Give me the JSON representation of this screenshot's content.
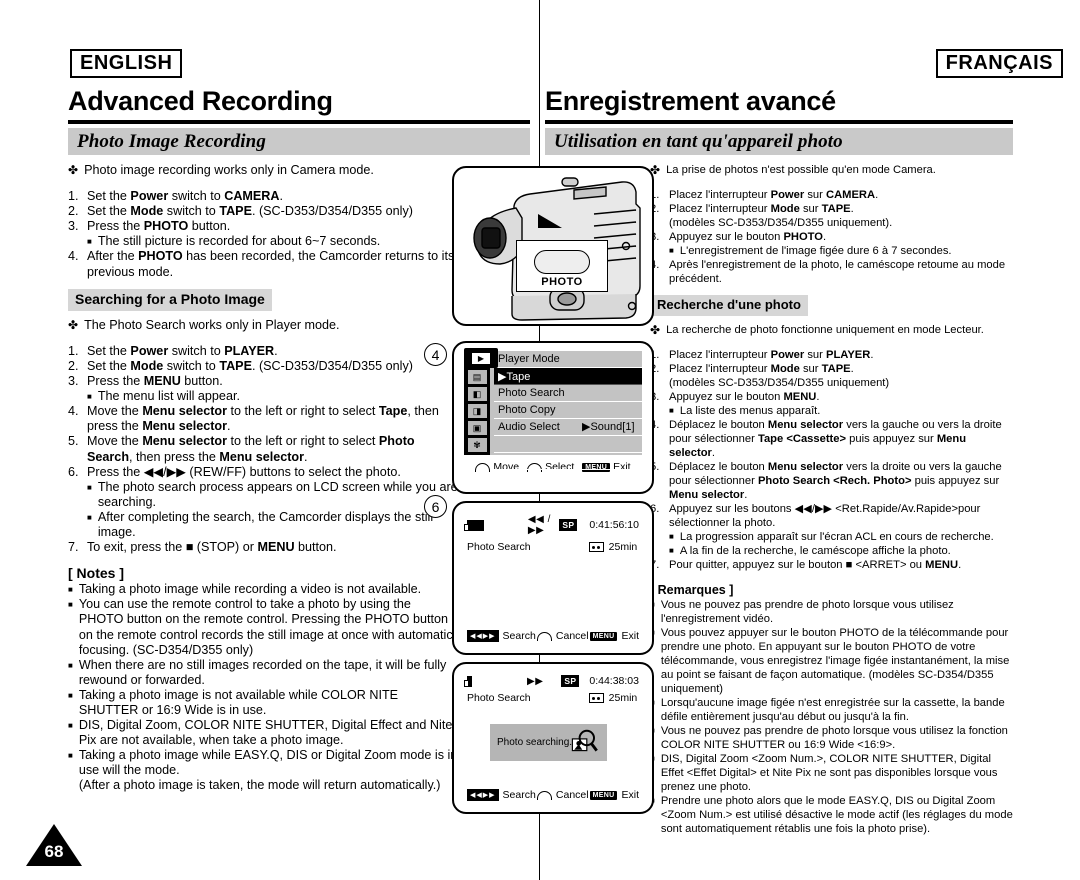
{
  "header": {
    "lang_en": "ENGLISH",
    "lang_fr": "FRANÇAIS",
    "title_en": "Advanced Recording",
    "title_fr": "Enregistrement avancé",
    "section_en": "Photo Image Recording",
    "section_fr": "Utilisation en tant qu'appareil photo"
  },
  "english": {
    "intro": "Photo image recording works only in Camera mode.",
    "steps1": [
      {
        "num": "1.",
        "html": "Set the <b>Power</b> switch to <b>CAMERA</b>."
      },
      {
        "num": "2.",
        "html": "Set the <b>Mode</b> switch to <b>TAPE</b>. (SC-D353/D354/D355 only)"
      },
      {
        "num": "3.",
        "html": "Press the <b>PHOTO</b> button."
      },
      {
        "num": "sub",
        "html": "The still picture is recorded for about 6~7 seconds."
      },
      {
        "num": "4.",
        "html": "After the <b>PHOTO</b> has been recorded, the Camcorder returns to its previous mode."
      }
    ],
    "subhead": "Searching for a Photo Image",
    "intro2": "The Photo Search works only in Player mode.",
    "steps2": [
      {
        "num": "1.",
        "html": "Set the <b>Power</b> switch to <b>PLAYER</b>."
      },
      {
        "num": "2.",
        "html": "Set the <b>Mode</b> switch to <b>TAPE</b>. (SC-D353/D354/D355 only)"
      },
      {
        "num": "3.",
        "html": "Press the <b>MENU</b> button."
      },
      {
        "num": "sub",
        "html": "The menu list will appear."
      },
      {
        "num": "4.",
        "html": "Move the <b>Menu selector</b> to the left or right to select <b>Tape</b>, then press the <b>Menu selector</b>."
      },
      {
        "num": "5.",
        "html": "Move the <b>Menu selector</b> to the left or right to select <b>Photo Search</b>, then press the <b>Menu selector</b>."
      },
      {
        "num": "6.",
        "html": "Press the ◀◀/▶▶ (REW/FF) buttons to select the photo."
      },
      {
        "num": "sub",
        "html": "The photo search process appears on LCD screen while you are searching."
      },
      {
        "num": "sub",
        "html": "After completing the search, the Camcorder displays the still image."
      },
      {
        "num": "7.",
        "html": "To exit, press the ■ (STOP) or <b>MENU</b> button."
      }
    ],
    "notes_title": "[ Notes ]",
    "notes": [
      "Taking a photo image while recording a video is not available.",
      "You can use the remote control to take a photo by using the PHOTO button on the remote control. Pressing the PHOTO button on the remote control records the still image at once with automatic focusing. (SC-D354/D355 only)",
      "When there are no still images recorded on the tape, it will be fully rewound or forwarded.",
      "Taking a photo image is not available while COLOR NITE SHUTTER or 16:9 Wide is in use.",
      "DIS, Digital Zoom, COLOR NITE SHUTTER, Digital Effect and Nite Pix are not available, when take a photo image.",
      "Taking a photo image while EASY.Q, DIS or Digital Zoom mode is in use will the mode.<br>(After a photo image is taken, the mode will return automatically.)"
    ]
  },
  "french": {
    "intro": "La prise de photos n'est possible qu'en mode Camera.",
    "steps1": [
      {
        "num": "1.",
        "html": "Placez l'interrupteur <b>Power</b> sur <b>CAMERA</b>."
      },
      {
        "num": "2.",
        "html": "Placez l'interrupteur <b>Mode</b> sur <b>TAPE</b>.<br>(modèles SC-D353/D354/D355 uniquement)."
      },
      {
        "num": "3.",
        "html": "Appuyez sur le bouton <b>PHOTO</b>."
      },
      {
        "num": "sub",
        "html": "L'enregistrement de l'image figée dure 6 à 7 secondes."
      },
      {
        "num": "4.",
        "html": "Après l'enregistrement de la photo, le caméscope retoume au mode précédent."
      }
    ],
    "subhead": "Recherche d'une photo",
    "intro2": "La recherche de photo fonctionne uniquement en mode Lecteur.",
    "steps2": [
      {
        "num": "1.",
        "html": "Placez l'interrupteur <b>Power</b> sur <b>PLAYER</b>."
      },
      {
        "num": "2.",
        "html": "Placez l'interrupteur <b>Mode</b> sur <b>TAPE</b>.<br>(modèles SC-D353/D354/D355 uniquement)"
      },
      {
        "num": "3.",
        "html": "Appuyez sur le bouton <b>MENU</b>."
      },
      {
        "num": "sub",
        "html": "La liste des menus apparaît."
      },
      {
        "num": "4.",
        "html": "Déplacez le bouton <b>Menu selector</b> vers la gauche ou vers la droite pour sélectionner <b>Tape &lt;Cassette&gt;</b> puis appuyez sur <b>Menu selector</b>."
      },
      {
        "num": "5.",
        "html": "Déplacez le bouton <b>Menu selector</b> vers la droite ou vers la gauche pour sélectionner <b>Photo Search &lt;Rech. Photo&gt;</b> puis appuyez sur <b>Menu selector</b>."
      },
      {
        "num": "6.",
        "html": "Appuyez sur les boutons ◀◀/▶▶ &lt;Ret.Rapide/Av.Rapide&gt;pour sélectionner la photo."
      },
      {
        "num": "sub",
        "html": "La progression apparaît sur l'écran ACL en cours de recherche."
      },
      {
        "num": "sub",
        "html": "A la fin de la recherche, le caméscope affiche la photo."
      },
      {
        "num": "7.",
        "html": "Pour quitter, appuyez sur le bouton ■ &lt;ARRET&gt; ou <b>MENU</b>."
      }
    ],
    "notes_title": "[ Remarques ]",
    "notes": [
      "Vous ne pouvez pas prendre de photo lorsque vous utilisez l'enregistrement vidéo.",
      "Vous pouvez appuyer sur le bouton PHOTO de la télécommande pour prendre une photo. En appuyant sur le bouton PHOTO de votre télécommande, vous enregistrez l'image figée instantanément, la mise au point se faisant de façon automatique. (modèles SC-D354/D355 uniquement)",
      "Lorsqu'aucune image figée n'est enregistrée sur la cassette, la bande défile entièrement jusqu'au début ou jusqu'à la fin.",
      "Vous ne pouvez pas prendre de photo lorsque vous utilisez la fonction COLOR NITE SHUTTER ou 16:9 Wide &lt;16:9&gt;.",
      "DIS, Digital Zoom &lt;Zoom Num.&gt;, COLOR NITE SHUTTER, Digital Effet &lt;Effet Digital&gt; et Nite Pix ne sont pas disponibles lorsque vous prenez une photo.",
      "Prendre une photo alors que le mode EASY.Q, DIS ou Digital Zoom &lt;Zoom Num.&gt; est utilisé désactive le mode actif (les réglages du mode sont automatiquement rétablis une fois la photo prise)."
    ]
  },
  "figures": {
    "camcorder": {
      "button_label": "PHOTO"
    },
    "step_markers": {
      "four": "4",
      "six": "6"
    },
    "menu_screen": {
      "title": "Player Mode",
      "items": [
        "▶Tape",
        "Photo Search",
        "Photo Copy",
        "Audio Select",
        "",
        ""
      ],
      "selected_index": 0,
      "submenu_value": "▶Sound[1]",
      "footer": {
        "move": "Move",
        "select": "Select",
        "menu_key": "MENU",
        "exit": "Exit"
      }
    },
    "lcd_search": {
      "mode_icons": "◀◀ / ▶▶",
      "quality": "SP",
      "timecode": "0:41:56:10",
      "label": "Photo Search",
      "tape_remain": "25min",
      "footer": {
        "search_key": "◀◀▶▶",
        "search": "Search",
        "cancel": "Cancel",
        "menu_key": "MENU",
        "exit": "Exit"
      }
    },
    "lcd_searching": {
      "mode_icons": "▶▶",
      "quality": "SP",
      "timecode": "0:44:38:03",
      "label": "Photo Search",
      "tape_remain": "25min",
      "overlay": "Photo searching...",
      "footer": {
        "search_key": "◀◀▶▶",
        "search": "Search",
        "cancel": "Cancel",
        "menu_key": "MENU",
        "exit": "Exit"
      }
    }
  },
  "page_number": "68"
}
